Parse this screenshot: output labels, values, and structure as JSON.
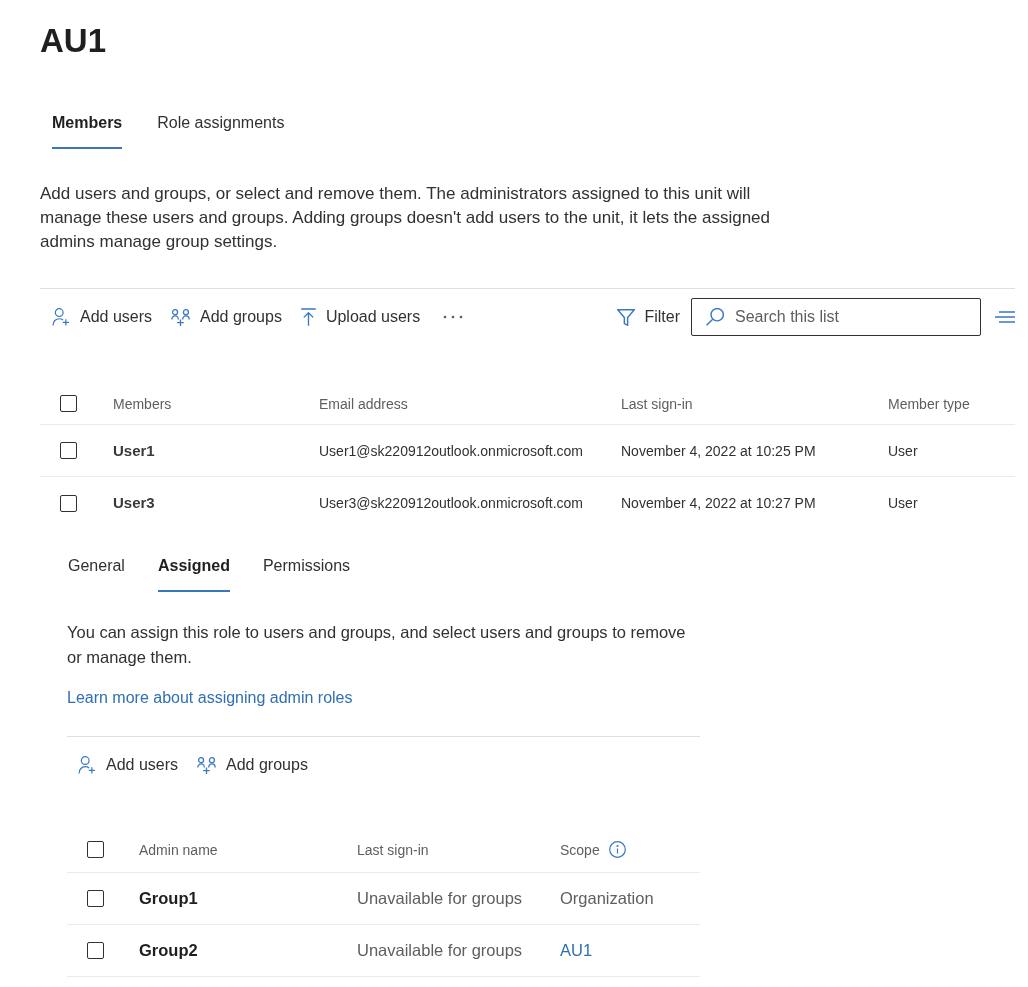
{
  "page": {
    "title": "AU1"
  },
  "unit_tabs": [
    {
      "label": "Members",
      "selected": true
    },
    {
      "label": "Role assignments",
      "selected": false
    }
  ],
  "members_description": "Add users and groups, or select and remove them. The administrators assigned to this unit will manage these users and groups. Adding groups doesn't add users to the unit, it lets the assigned admins manage group settings.",
  "members_toolbar": {
    "actions": [
      {
        "kind": "user",
        "label": "Add users"
      },
      {
        "kind": "group",
        "label": "Add groups"
      },
      {
        "kind": "upload",
        "label": "Upload users"
      }
    ],
    "filter": {
      "label": "Filter"
    },
    "search": {
      "placeholder": "Search this list"
    }
  },
  "members_table": {
    "select_all": {
      "checked": false
    },
    "columns": [
      "Members",
      "Email address",
      "Last sign-in",
      "Member type"
    ],
    "rows": [
      {
        "checked": false,
        "cells": [
          "User1",
          "User1@sk220912outlook.onmicrosoft.com",
          "November 4, 2022 at 10:25 PM",
          "User"
        ]
      },
      {
        "checked": false,
        "cells": [
          "User3",
          "User3@sk220912outlook.onmicrosoft.com",
          "November 4, 2022 at 10:27 PM",
          "User"
        ]
      }
    ]
  },
  "role_tabs": [
    {
      "label": "General",
      "selected": false
    },
    {
      "label": "Assigned",
      "selected": true
    },
    {
      "label": "Permissions",
      "selected": false
    }
  ],
  "role_description": "You can assign this role to users and groups, and select users and groups to remove or manage them.",
  "role_link": "Learn more about assigning admin roles",
  "role_toolbar": {
    "actions": [
      {
        "kind": "user",
        "label": "Add users"
      },
      {
        "kind": "group",
        "label": "Add groups"
      }
    ]
  },
  "role_table": {
    "select_all": {
      "checked": false
    },
    "columns": [
      {
        "label": "Admin name"
      },
      {
        "label": "Last sign-in"
      },
      {
        "label": "Scope",
        "info": true
      }
    ],
    "rows": [
      {
        "checked": false,
        "name": "Group1",
        "last_sign_in": "Unavailable for groups",
        "scope": {
          "text": "Organization",
          "kind": "text"
        }
      },
      {
        "checked": false,
        "name": "Group2",
        "last_sign_in": "Unavailable for groups",
        "scope": {
          "text": "AU1",
          "kind": "link"
        }
      }
    ]
  }
}
